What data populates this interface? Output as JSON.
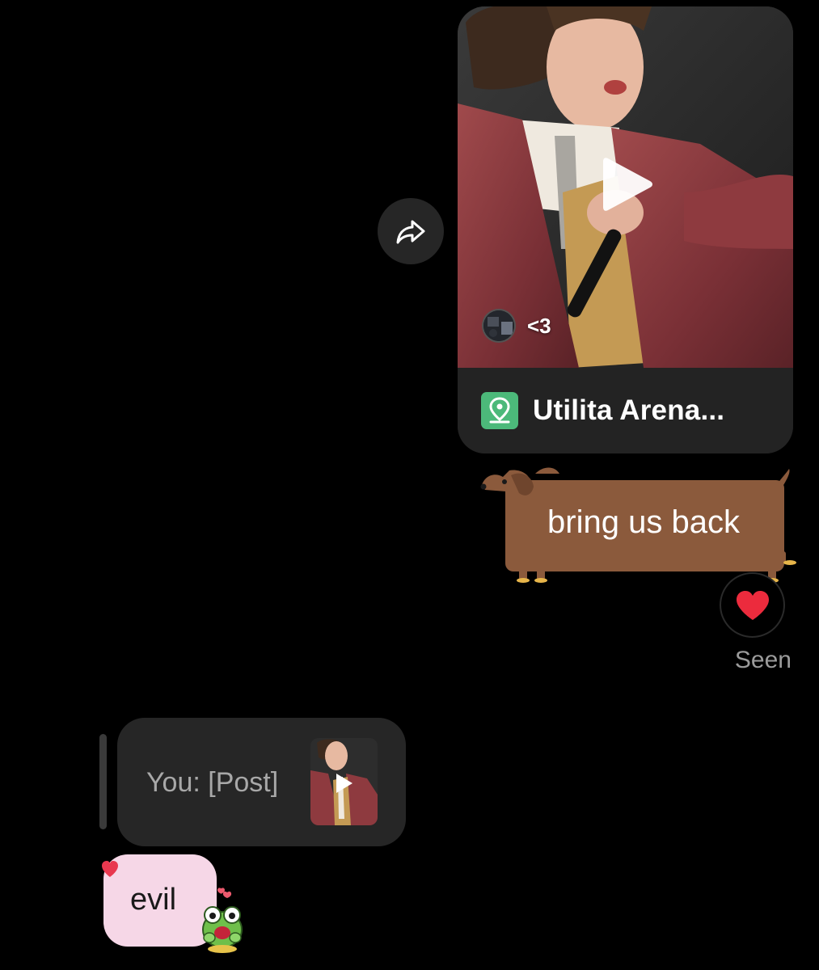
{
  "reel": {
    "author_name": "<3",
    "location": "Utilita Arena..."
  },
  "messages": {
    "outgoing_text": "bring us back",
    "reaction": "❤️",
    "status": "Seen"
  },
  "reply": {
    "quote_text": "You: [Post]"
  },
  "incoming": {
    "text": "evil"
  },
  "colors": {
    "background": "#000000",
    "card": "#232323",
    "dog_body": "#8b5a3c",
    "evil_bubble": "#f6d7e7",
    "location_badge": "#4cb97a"
  },
  "icons": [
    "share-icon",
    "play-icon",
    "location-pin-icon",
    "heart-icon",
    "frog-sticker-icon"
  ]
}
